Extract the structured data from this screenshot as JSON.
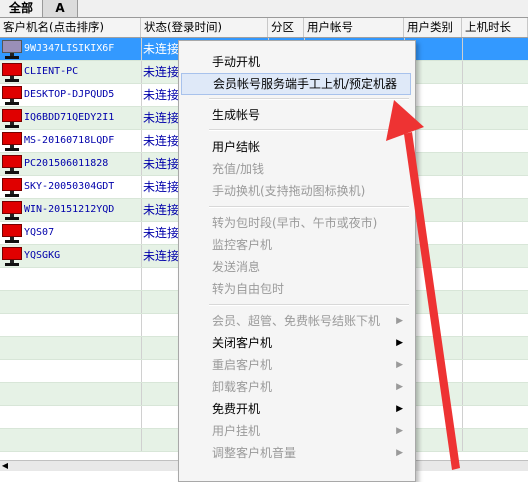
{
  "tabs": [
    "全部",
    "A"
  ],
  "columns": [
    "客户机名(点击排序)",
    "状态(登录时间)",
    "分区",
    "用户帐号",
    "用户类别",
    "上机时长"
  ],
  "clients": [
    {
      "name": "9WJ347LISIKIX6F",
      "status": "未连接"
    },
    {
      "name": "CLIENT-PC",
      "status": "未连接"
    },
    {
      "name": "DESKTOP-DJPQUD5",
      "status": "未连接"
    },
    {
      "name": "IQ6BDD71QEDY2I1",
      "status": "未连接"
    },
    {
      "name": "MS-20160718LQDF",
      "status": "未连接"
    },
    {
      "name": "PC201506011828",
      "status": "未连接"
    },
    {
      "name": "SKY-20050304GDT",
      "status": "未连接"
    },
    {
      "name": "WIN-20151212YQD",
      "status": "未连接"
    },
    {
      "name": "YQS07",
      "status": "未连接"
    },
    {
      "name": "YQSGKG",
      "status": "未连接"
    }
  ],
  "menu": [
    {
      "label": "手动开机",
      "disabled": false
    },
    {
      "label": "会员帐号服务端手工上机/预定机器",
      "disabled": false
    },
    {
      "label": "生成帐号",
      "disabled": false
    },
    {
      "label": "用户结帐",
      "disabled": false
    },
    {
      "label": "充值/加钱",
      "disabled": true
    },
    {
      "label": "手动换机(支持拖动图标换机)",
      "disabled": true
    },
    {
      "label": "转为包时段(早市、午市或夜市)",
      "disabled": true
    },
    {
      "label": "监控客户机",
      "disabled": true
    },
    {
      "label": "发送消息",
      "disabled": true
    },
    {
      "label": "转为自由包时",
      "disabled": true
    },
    {
      "label": "会员、超管、免费帐号结账下机",
      "disabled": true
    },
    {
      "label": "关闭客户机",
      "disabled": false
    },
    {
      "label": "重启客户机",
      "disabled": true
    },
    {
      "label": "卸载客户机",
      "disabled": true
    },
    {
      "label": "免费开机",
      "disabled": false
    },
    {
      "label": "用户挂机",
      "disabled": true
    },
    {
      "label": "调整客户机音量",
      "disabled": true
    }
  ],
  "colors": {
    "selected_row": "#3399ff",
    "alt_row": "#e6f2e6",
    "client_text": "#0000aa",
    "monitor_red": "#e00000",
    "annotation_arrow": "#ee3333",
    "menu_highlight": "#dfe9f8"
  },
  "icons": {
    "client": "monitor-icon",
    "submenu": "submenu-arrow-icon"
  }
}
